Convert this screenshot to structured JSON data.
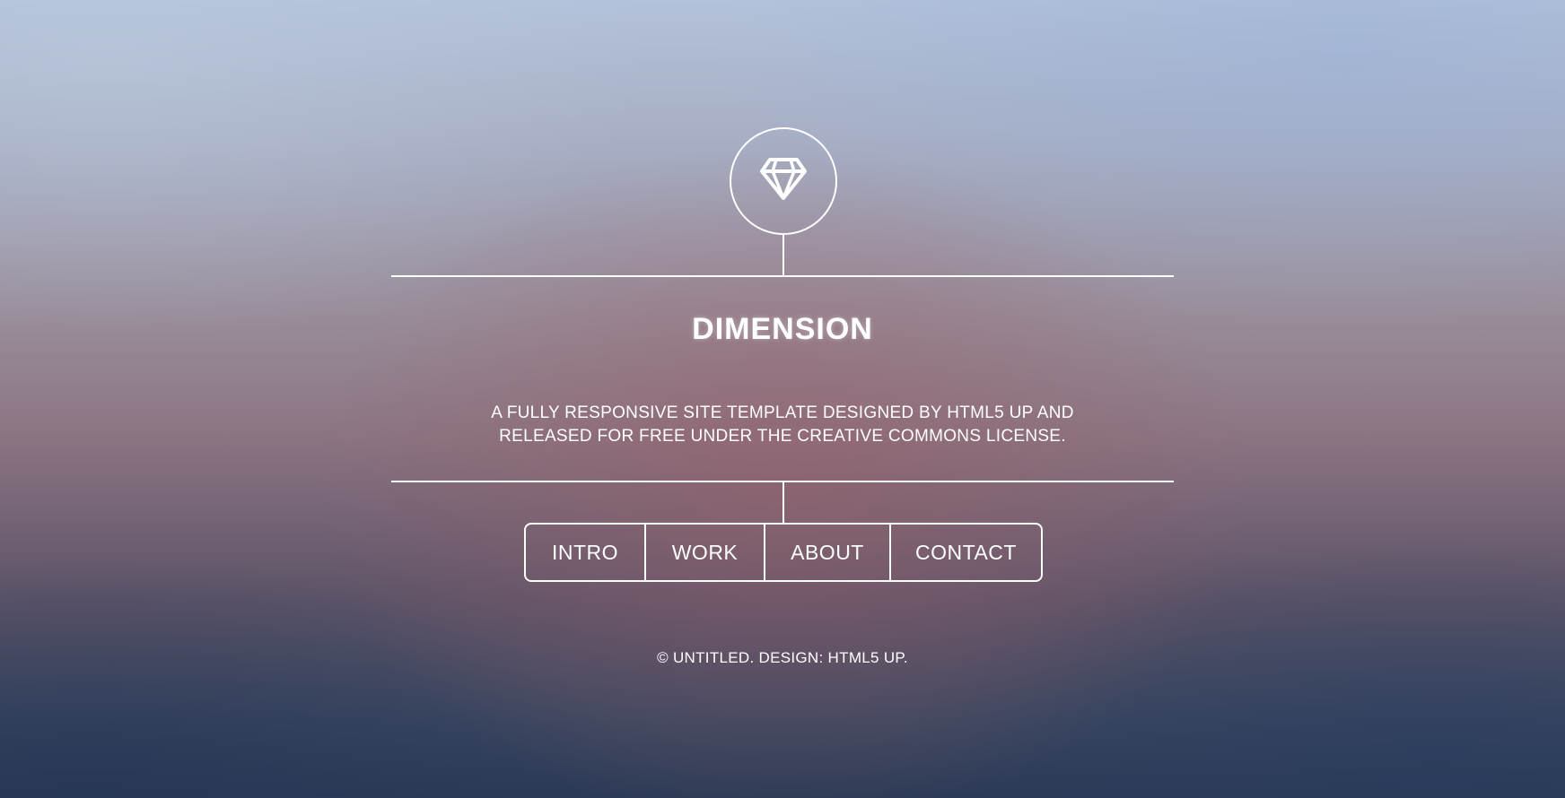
{
  "header": {
    "logo_icon": "diamond-icon",
    "title": "DIMENSION",
    "subtitle": "A FULLY RESPONSIVE SITE TEMPLATE DESIGNED BY HTML5 UP AND RELEASED FOR FREE UNDER THE CREATIVE COMMONS LICENSE."
  },
  "nav": {
    "items": [
      {
        "label": "INTRO"
      },
      {
        "label": "WORK"
      },
      {
        "label": "ABOUT"
      },
      {
        "label": "CONTACT"
      }
    ]
  },
  "footer": {
    "copyright": "© UNTITLED. DESIGN: HTML5 UP."
  },
  "colors": {
    "text": "#ffffff",
    "line": "#ffffff"
  }
}
